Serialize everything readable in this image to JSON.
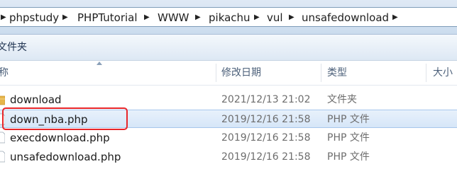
{
  "address_bar": {
    "crumbs": [
      "phpstudy",
      "PHPTutorial",
      "WWW",
      "pikachu",
      "vul",
      "unsafedownload"
    ]
  },
  "toolbar": {
    "new_folder_label": "文件夹"
  },
  "columns": {
    "name": "称",
    "date": "修改日期",
    "type": "类型",
    "size": "大小"
  },
  "files": [
    {
      "name": "download",
      "date": "2021/12/13 21:02",
      "type": "文件夹",
      "icon": "folder-icon",
      "selected": false
    },
    {
      "name": "down_nba.php",
      "date": "2019/12/16 21:58",
      "type": "PHP 文件",
      "icon": "php-file-icon",
      "selected": true
    },
    {
      "name": "execdownload.php",
      "date": "2019/12/16 21:58",
      "type": "PHP 文件",
      "icon": "php-file-icon",
      "selected": false
    },
    {
      "name": "unsafedownload.php",
      "date": "2019/12/16 21:58",
      "type": "PHP 文件",
      "icon": "php-file-icon",
      "selected": false
    }
  ],
  "colors": {
    "highlight": "#e8262a",
    "selection": "#d6e6f8",
    "folder": "#e6b54a"
  }
}
